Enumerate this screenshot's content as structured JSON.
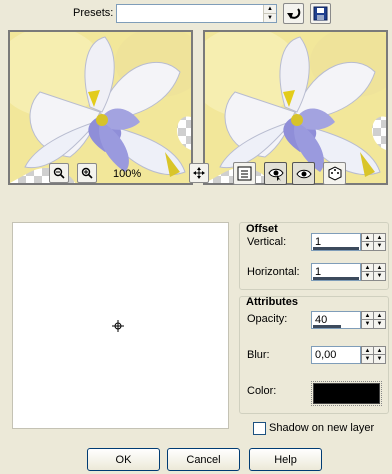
{
  "presets": {
    "label": "Presets:",
    "value": ""
  },
  "zoom": {
    "level": "100%"
  },
  "offset": {
    "title": "Offset",
    "vertical_label": "Vertical:",
    "vertical_value": "1",
    "horizontal_label": "Horizontal:",
    "horizontal_value": "1"
  },
  "attributes": {
    "title": "Attributes",
    "opacity_label": "Opacity:",
    "opacity_value": "40",
    "blur_label": "Blur:",
    "blur_value": "0,00",
    "color_label": "Color:",
    "color_hex": "#000000"
  },
  "shadow_option": {
    "label": "Shadow on new layer",
    "checked": false
  },
  "buttons": {
    "ok": "OK",
    "cancel": "Cancel",
    "help": "Help"
  },
  "icons": {
    "reset": "reset-arrow-icon",
    "save_preset": "save-disk-icon",
    "zoom_out": "zoom-out-icon",
    "zoom_in": "zoom-in-icon",
    "pan": "pan-move-icon",
    "proof": "proof-icon",
    "eye_toggle_1": "eye-pointer-icon",
    "eye_toggle_2": "eye-icon",
    "randomize": "dice-icon",
    "shadow_origin": "shadow-origin-crosshair-icon"
  }
}
